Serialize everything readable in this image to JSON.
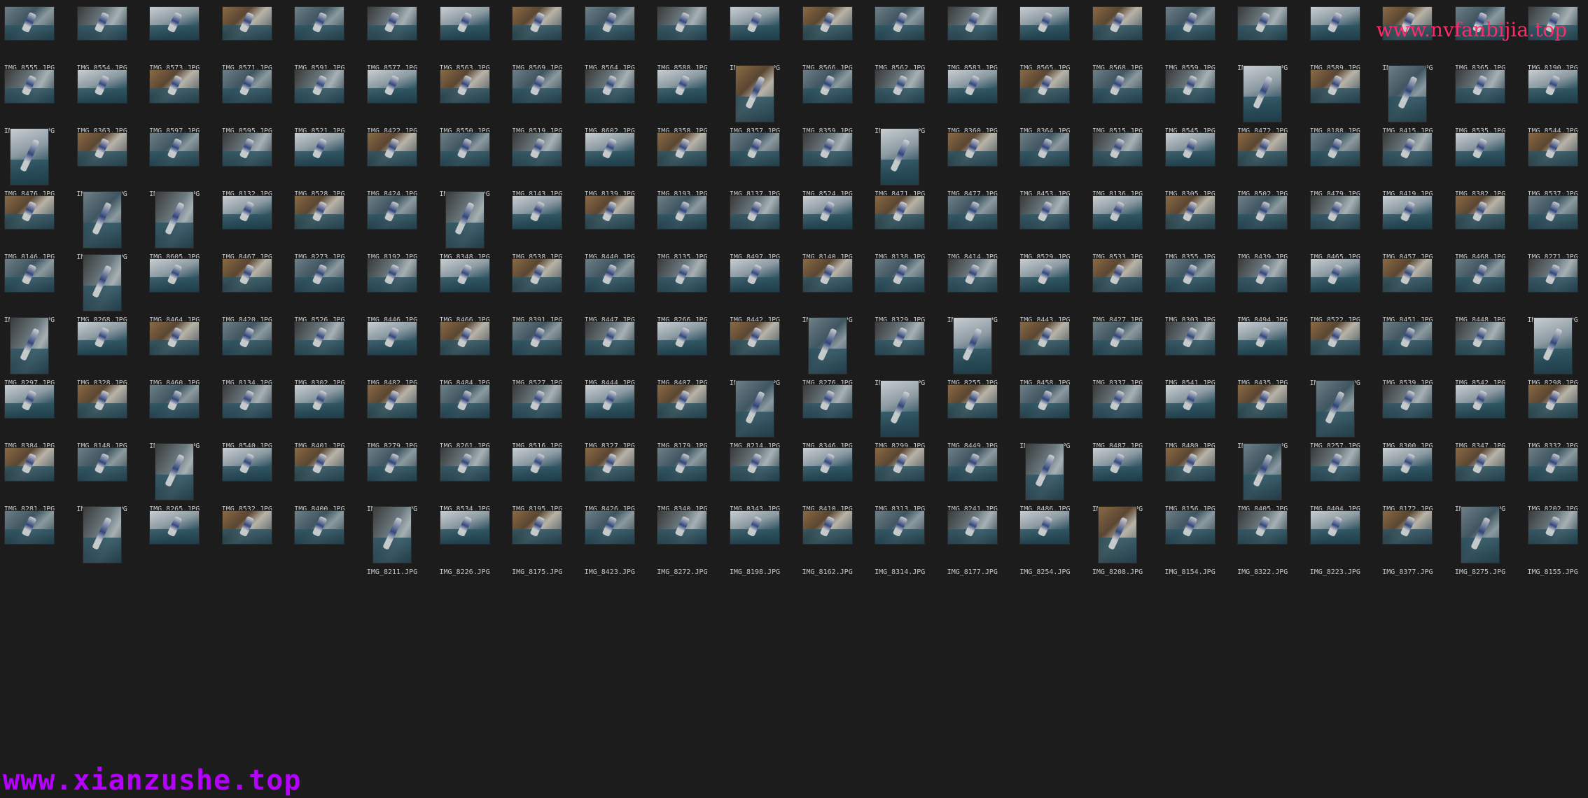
{
  "watermarks": {
    "top_right": "www.nvfanbijia.top",
    "bottom_left": "www.xianzushe.top"
  },
  "files": [
    [
      "IMG_8555.JPG",
      "IMG_8554.JPG",
      "IMG_8573.JPG",
      "IMG_8571.JPG",
      "IMG_8591.JPG",
      "IMG_8577.JPG",
      "IMG_8563.JPG",
      "IMG_8569.JPG",
      "IMG_8564.JPG",
      "IMG_8588.JPG",
      "IMG_8558.JPG",
      "IMG_8566.JPG",
      "IMG_8562.JPG",
      "IMG_8583.JPG",
      "IMG_8565.JPG",
      "IMG_8568.JPG",
      "IMG_8559.JPG",
      "IMG_8579.JPG",
      "IMG_8589.JPG",
      "IMG_8593.JPG",
      "IMG_8365.JPG",
      "IMG_8190.JPG"
    ],
    [
      "IMG_8518.JPG",
      "IMG_8363.JPG",
      "IMG_8597.JPG",
      "IMG_8595.JPG",
      "IMG_8521.JPG",
      "IMG_8422.JPG",
      "IMG_8550.JPG",
      "IMG_8519.JPG",
      "IMG_8602.JPG",
      "IMG_8358.JPG",
      "IMG_8357.JPG",
      "IMG_8359.JPG",
      "IMG_8144.JPG",
      "IMG_8360.JPG",
      "IMG_8364.JPG",
      "IMG_8515.JPG",
      "IMG_8545.JPG",
      "IMG_8472.JPG",
      "IMG_8188.JPG",
      "IMG_8415.JPG",
      "IMG_8535.JPG",
      "IMG_8544.JPG"
    ],
    [
      "IMG_8476.JPG",
      "IMG_8489.JPG",
      "IMG_8362.JPG",
      "IMG_8132.JPG",
      "IMG_8528.JPG",
      "IMG_8424.JPG",
      "IMG_8551.JPG",
      "IMG_8143.JPG",
      "IMG_8139.JPG",
      "IMG_8193.JPG",
      "IMG_8137.JPG",
      "IMG_8524.JPG",
      "IMG_8471.JPG",
      "IMG_8477.JPG",
      "IMG_8453.JPG",
      "IMG_8136.JPG",
      "IMG_8305.JPG",
      "IMG_8502.JPG",
      "IMG_8479.JPG",
      "IMG_8419.JPG",
      "IMG_8382.JPG",
      "IMG_8537.JPG"
    ],
    [
      "IMG_8146.JPG",
      "IMG_8406.JPG",
      "IMG_8605.JPG",
      "IMG_8467.JPG",
      "IMG_8273.JPG",
      "IMG_8192.JPG",
      "IMG_8348.JPG",
      "IMG_8538.JPG",
      "IMG_8440.JPG",
      "IMG_8135.JPG",
      "IMG_8497.JPG",
      "IMG_8140.JPG",
      "IMG_8138.JPG",
      "IMG_8414.JPG",
      "IMG_8529.JPG",
      "IMG_8533.JPG",
      "IMG_8355.JPG",
      "IMG_8439.JPG",
      "IMG_8465.JPG",
      "IMG_8457.JPG",
      "IMG_8468.JPG",
      "IMG_8271.JPG"
    ],
    [
      "IMG_8441.JPG",
      "IMG_8268.JPG",
      "IMG_8464.JPG",
      "IMG_8420.JPG",
      "IMG_8526.JPG",
      "IMG_8446.JPG",
      "IMG_8466.JPG",
      "IMG_8391.JPG",
      "IMG_8447.JPG",
      "IMG_8266.JPG",
      "IMG_8442.JPG",
      "IMG_8504.JPG",
      "IMG_8329.JPG",
      "IMG_8133.JPG",
      "IMG_8443.JPG",
      "IMG_8427.JPG",
      "IMG_8303.JPG",
      "IMG_8494.JPG",
      "IMG_8522.JPG",
      "IMG_8451.JPG",
      "IMG_8448.JPG",
      "IMG_8508.JPG"
    ],
    [
      "IMG_8297.JPG",
      "IMG_8328.JPG",
      "IMG_8460.JPG",
      "IMG_8134.JPG",
      "IMG_8302.JPG",
      "IMG_8482.JPG",
      "IMG_8484.JPG",
      "IMG_8527.JPG",
      "IMG_8444.JPG",
      "IMG_8407.JPG",
      "IMG_8543.JPG",
      "IMG_8276.JPG",
      "IMG_8256.JPG",
      "IMG_8255.JPG",
      "IMG_8458.JPG",
      "IMG_8337.JPG",
      "IMG_8541.JPG",
      "IMG_8435.JPG",
      "IMG_8380.JPG",
      "IMG_8539.JPG",
      "IMG_8542.JPG",
      "IMG_8298.JPG"
    ],
    [
      "IMG_8384.JPG",
      "IMG_8148.JPG",
      "IMG_8204.JPG",
      "IMG_8540.JPG",
      "IMG_8401.JPG",
      "IMG_8279.JPG",
      "IMG_8261.JPG",
      "IMG_8516.JPG",
      "IMG_8327.JPG",
      "IMG_8179.JPG",
      "IMG_8214.JPG",
      "IMG_8346.JPG",
      "IMG_8299.JPG",
      "IMG_8449.JPG",
      "IMG_8366.JPG",
      "IMG_8487.JPG",
      "IMG_8480.JPG",
      "IMG_8284.JPG",
      "IMG_8257.JPG",
      "IMG_8300.JPG",
      "IMG_8347.JPG",
      "IMG_8332.JPG"
    ],
    [
      "IMG_8281.JPG",
      "IMG_8452.JPG",
      "IMG_8265.JPG",
      "IMG_8532.JPG",
      "IMG_8400.JPG",
      "IMG_8455.JPG",
      "IMG_8534.JPG",
      "IMG_8195.JPG",
      "IMG_8426.JPG",
      "IMG_8340.JPG",
      "IMG_8343.JPG",
      "IMG_8410.JPG",
      "IMG_8313.JPG",
      "IMG_8241.JPG",
      "IMG_8486.JPG",
      "IMG_8182.JPG",
      "IMG_8156.JPG",
      "IMG_8405.JPG",
      "IMG_8404.JPG",
      "IMG_8172.JPG",
      "IMG_8197.JPG",
      "IMG_8202.JPG"
    ],
    [
      "",
      "",
      "",
      "",
      "",
      "IMG_8211.JPG",
      "IMG_8226.JPG",
      "IMG_8175.JPG",
      "IMG_8423.JPG",
      "IMG_8272.JPG",
      "IMG_8198.JPG",
      "IMG_8162.JPG",
      "IMG_8314.JPG",
      "IMG_8177.JPG",
      "IMG_8254.JPG",
      "IMG_8208.JPG",
      "IMG_8154.JPG",
      "IMG_8322.JPG",
      "IMG_8223.JPG",
      "IMG_8377.JPG",
      "IMG_8275.JPG",
      "IMG_8155.JPG"
    ]
  ],
  "orientation": [
    "LLLLLLLLLLLLLLLLLLLLLL",
    "LLLLLLLLLLPLLLLLLPLPLL",
    "PLLLLLLLLLLLPLLLLLLLLL",
    "LPPLLLPLLLLLLLLLLLLLLL",
    "LPLLLLLLLLLLLLLLLLLLLL",
    "PLLLLLLLLLLPLPLLLLLLLP",
    "LLLLLLLLLLPLPLLLLLPLLL",
    "LLPLLLLLLLLLLLPLLPLLLL",
    "LPLLLPLLLLLLLLLPLLLLPL"
  ]
}
